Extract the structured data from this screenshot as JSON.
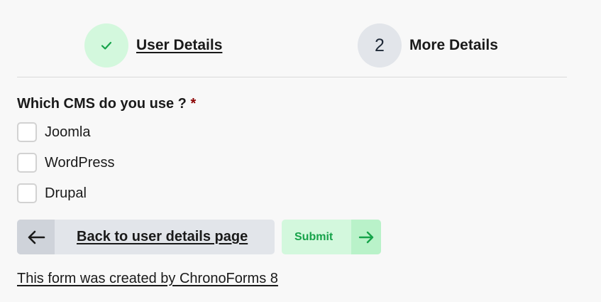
{
  "steps": [
    {
      "label": "User Details",
      "status": "completed",
      "icon": "check-icon"
    },
    {
      "number": "2",
      "label": "More Details",
      "status": "pending"
    }
  ],
  "question": {
    "label": "Which CMS do you use ?",
    "required_marker": "*"
  },
  "options": [
    {
      "label": "Joomla",
      "checked": false
    },
    {
      "label": "WordPress",
      "checked": false
    },
    {
      "label": "Drupal",
      "checked": false
    }
  ],
  "buttons": {
    "back": {
      "label": "Back to user details page",
      "icon": "arrow-left-icon"
    },
    "submit": {
      "label": "Submit",
      "icon": "arrow-right-icon"
    }
  },
  "footer": {
    "credit": "This form was created by ChronoForms 8"
  },
  "colors": {
    "background": "#f8f8f8",
    "completed_step": "#d3f8dd",
    "check": "#16a34a",
    "pending_step": "#e2e5ea",
    "required": "#8b0000",
    "submit_text": "#17a34a",
    "submit_bg": "#d3f8dd"
  }
}
